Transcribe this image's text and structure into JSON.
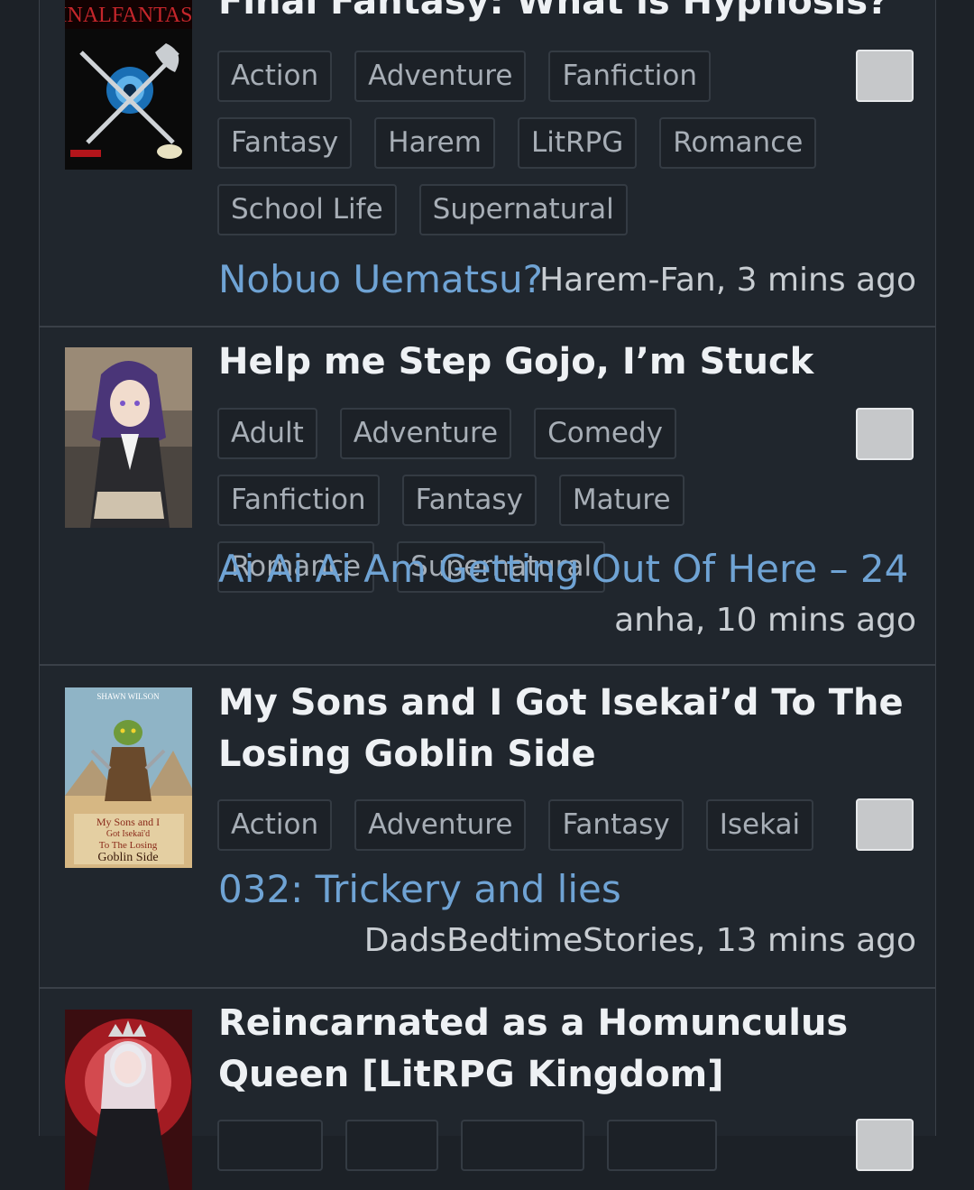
{
  "stories": [
    {
      "title": "Final Fantasy: What is Hypnosis?",
      "cover_text": "FINALFANTASY",
      "tags": [
        "Action",
        "Adventure",
        "Fanfiction",
        "Fantasy",
        "Harem",
        "LitRPG",
        "Romance",
        "School Life",
        "Supernatural"
      ],
      "chapter": "Nobuo Uematsu?",
      "meta": "Harem-Fan, 3 mins ago"
    },
    {
      "title": "Help me Step Gojo, I’m Stuck",
      "tags": [
        "Adult",
        "Adventure",
        "Comedy",
        "Fanfiction",
        "Fantasy",
        "Mature",
        "Romance",
        "Supernatural"
      ],
      "chapter": "Ai Ai Ai Am Getting Out Of Here – 24",
      "meta": "anha, 10 mins ago"
    },
    {
      "title": "My Sons and I Got Isekai’d To The Losing Goblin Side",
      "cover_author": "SHAWN WILSON",
      "cover_title_1": "My Sons and I",
      "cover_title_2": "Got Isekai'd",
      "cover_title_3": "To The Losing",
      "cover_title_4": "Goblin Side",
      "tags": [
        "Action",
        "Adventure",
        "Fantasy",
        "Isekai"
      ],
      "chapter": "032: Trickery and lies",
      "meta": "DadsBedtimeStories, 13 mins ago"
    },
    {
      "title": "Reincarnated as a Homunculus Queen [LitRPG Kingdom]",
      "tags": [],
      "chapter": "",
      "meta": ""
    }
  ],
  "colors": {
    "background": "#1c2127",
    "panel": "#20262d",
    "link": "#6fa3d4",
    "title": "#eef1f4"
  }
}
